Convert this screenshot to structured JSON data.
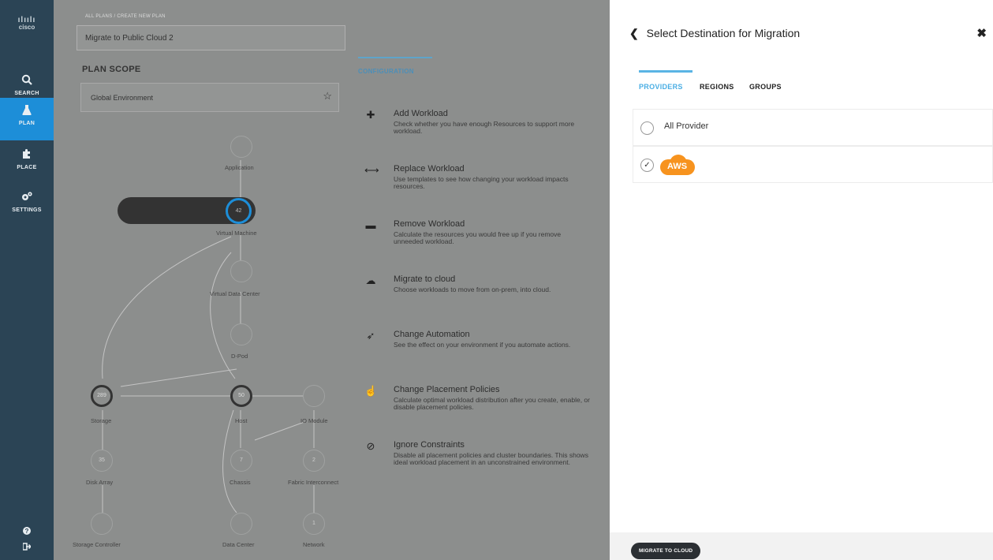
{
  "sidebar": {
    "logo_text": "cisco",
    "items": [
      {
        "label": "SEARCH",
        "icon": "search-icon"
      },
      {
        "label": "PLAN",
        "icon": "flask-icon"
      },
      {
        "label": "PLACE",
        "icon": "puzzle-icon"
      },
      {
        "label": "SETTINGS",
        "icon": "gear-icon"
      }
    ],
    "active_color": "#1d8ed8"
  },
  "main": {
    "breadcrumb": "ALL PLANS / CREATE NEW PLAN",
    "plan_name": "Migrate to Public Cloud 2",
    "scope_title": "PLAN SCOPE",
    "scope_value": "Global Environment",
    "graph": {
      "vm_count": "42",
      "nodes": [
        {
          "label": "Application"
        },
        {
          "label": "Virtual Machine"
        },
        {
          "label": "Virtual Data Center"
        },
        {
          "label": "D-Pod"
        },
        {
          "label": "Storage",
          "value": "289"
        },
        {
          "label": "Host",
          "value": "50"
        },
        {
          "label": "IO Module"
        },
        {
          "label": "Disk Array",
          "value": "35"
        },
        {
          "label": "Chassis",
          "value": "7"
        },
        {
          "label": "Fabric Interconnect",
          "value": "2"
        },
        {
          "label": "Storage Controller"
        },
        {
          "label": "Data Center"
        },
        {
          "label": "Network",
          "value": "1"
        }
      ]
    },
    "configuration": {
      "tab": "CONFIGURATION",
      "items": [
        {
          "title": "Add Workload",
          "desc": "Check whether you have enough Resources to support more workload.",
          "icon": "plus-icon"
        },
        {
          "title": "Replace Workload",
          "desc": "Use templates to see how changing your workload impacts resources.",
          "icon": "swap-icon"
        },
        {
          "title": "Remove Workload",
          "desc": "Calculate the resources you would free up if you remove unneeded workload.",
          "icon": "minus-icon"
        },
        {
          "title": "Migrate to cloud",
          "desc": "Choose workloads to move from on-prem, into cloud.",
          "icon": "cloud-upload-icon"
        },
        {
          "title": "Change Automation",
          "desc": "See the effect on your environment if you automate actions.",
          "icon": "rocket-icon"
        },
        {
          "title": "Change Placement Policies",
          "desc": "Calculate optimal workload distribution after you create, enable, or disable placement policies.",
          "icon": "hand-icon"
        },
        {
          "title": "Ignore Constraints",
          "desc": "Disable all placement policies and cluster boundaries. This shows ideal workload placement in an unconstrained environment.",
          "icon": "prohibit-icon"
        }
      ]
    }
  },
  "panel": {
    "title": "Select Destination for Migration",
    "tabs": [
      "PROVIDERS",
      "REGIONS",
      "GROUPS"
    ],
    "options": [
      {
        "label": "All Provider",
        "selected": false
      },
      {
        "label": "AWS",
        "selected": true
      }
    ],
    "aws_color": "#f7931e",
    "button": "MIGRATE TO CLOUD"
  }
}
